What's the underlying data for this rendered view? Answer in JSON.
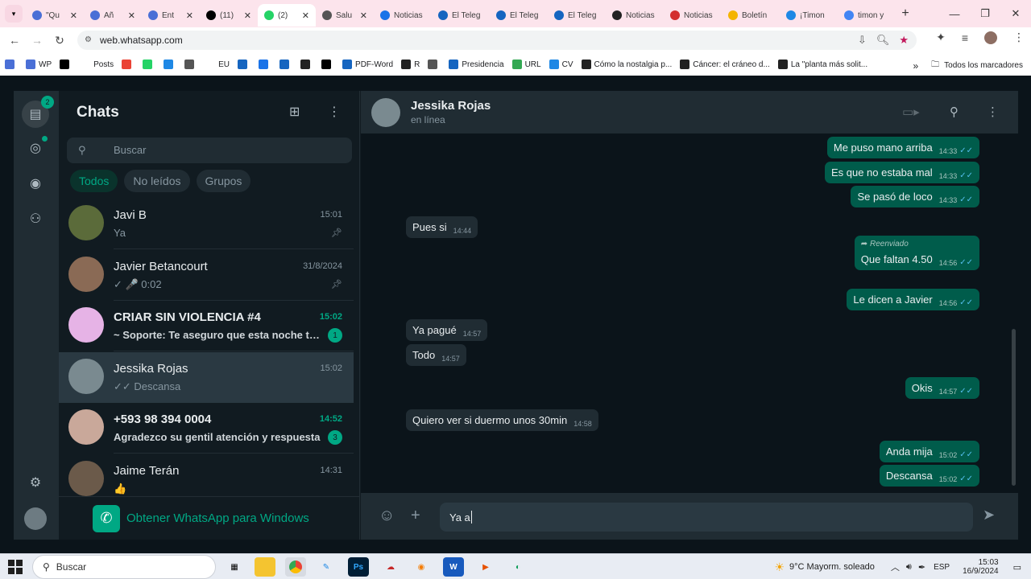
{
  "browser": {
    "tabs": [
      {
        "label": "\"Qu",
        "icon": "cw-icon",
        "color": "#4a6fd6"
      },
      {
        "label": "Añ",
        "icon": "cw-icon",
        "color": "#4a6fd6"
      },
      {
        "label": "Ent",
        "icon": "cw-icon",
        "color": "#4a6fd6"
      },
      {
        "label": "(11)",
        "icon": "x-icon",
        "color": "#000000"
      },
      {
        "label": "(2)",
        "icon": "whatsapp-icon",
        "color": "#25d366",
        "active": true
      },
      {
        "label": "Salu",
        "icon": "globe-icon",
        "color": "#555555"
      },
      {
        "label": "Noticias",
        "icon": "ec-icon",
        "color": "#1a73e8"
      },
      {
        "label": "El Teleg",
        "icon": "telegrafo-icon",
        "color": "#1565c0"
      },
      {
        "label": "El Teleg",
        "icon": "telegrafo-icon",
        "color": "#1565c0"
      },
      {
        "label": "El Teleg",
        "icon": "telegrafo-icon",
        "color": "#1565c0"
      },
      {
        "label": "Noticias",
        "icon": "dots-icon",
        "color": "#222222"
      },
      {
        "label": "Noticias",
        "icon": "ta-icon",
        "color": "#d32f2f"
      },
      {
        "label": "Boletín",
        "icon": "boletin-icon",
        "color": "#f4b400"
      },
      {
        "label": "¡Timon",
        "icon": "copilot-icon",
        "color": "#1e88e5"
      },
      {
        "label": "timon y",
        "icon": "google-icon",
        "color": "#4285f4"
      }
    ],
    "url": "web.whatsapp.com",
    "bookmarks": [
      {
        "label": "",
        "color": "#4a6fd6"
      },
      {
        "label": "WP",
        "color": "#4a6fd6"
      },
      {
        "label": "",
        "color": "#000000"
      },
      {
        "label": "Posts",
        "color": "#ffffff"
      },
      {
        "label": "",
        "color": "#ea4335"
      },
      {
        "label": "",
        "color": "#25d366"
      },
      {
        "label": "",
        "color": "#1e88e5"
      },
      {
        "label": "",
        "color": "#555555"
      },
      {
        "label": "EU",
        "color": "#ffffff"
      },
      {
        "label": "",
        "color": "#1565c0"
      },
      {
        "label": "",
        "color": "#1a73e8"
      },
      {
        "label": "",
        "color": "#1565c0"
      },
      {
        "label": "",
        "color": "#222222"
      },
      {
        "label": "",
        "color": "#000000"
      },
      {
        "label": "PDF-Word",
        "color": "#1565c0"
      },
      {
        "label": "R",
        "color": "#222222"
      },
      {
        "label": "",
        "color": "#555555"
      },
      {
        "label": "Presidencia",
        "color": "#1565c0"
      },
      {
        "label": "URL",
        "color": "#34a853"
      },
      {
        "label": "CV",
        "color": "#1e88e5"
      },
      {
        "label": "Cómo la nostalgia p...",
        "color": "#222222"
      },
      {
        "label": "Cáncer: el cráneo d...",
        "color": "#222222"
      },
      {
        "label": "La \"planta más solit...",
        "color": "#222222"
      }
    ],
    "all_bookmarks": "Todos los marcadores"
  },
  "app": {
    "rail_badge": "2",
    "title": "Chats",
    "search_placeholder": "Buscar",
    "filters": [
      {
        "label": "Todos",
        "active": true
      },
      {
        "label": "No leídos",
        "active": false
      },
      {
        "label": "Grupos",
        "active": false
      }
    ],
    "chats": [
      {
        "name": "Javi B",
        "preview": "Ya",
        "time": "15:01",
        "pinned": true,
        "avatar": "#5b6b3a"
      },
      {
        "name": "Javier Betancourt",
        "preview": "✓ 🎤 0:02",
        "time": "31/8/2024",
        "pinned": true,
        "avatar": "#8a6a55"
      },
      {
        "name": "CRIAR SIN VIOLENCIA #4",
        "preview": "~ Soporte: Te aseguro que esta noche tu cab...",
        "time": "15:02",
        "unread": "1",
        "bold": true,
        "avatar": "#e6b3e6"
      },
      {
        "name": "Jessika Rojas",
        "preview": "✓✓ Descansa",
        "time": "15:02",
        "selected": true,
        "avatar": "#7a8a90"
      },
      {
        "name": "+593 98 394 0004",
        "preview": "Agradezco su gentil atención y respuesta",
        "time": "14:52",
        "unread": "3",
        "bold": true,
        "avatar": "#c9a89a"
      },
      {
        "name": "Jaime Terán",
        "preview": "👍",
        "time": "14:31",
        "avatar": "#6b5a4a"
      }
    ],
    "get_windows": "Obtener WhatsApp para Windows",
    "contact": {
      "name": "Jessika Rojas",
      "status": "en línea"
    },
    "messages": [
      {
        "dir": "out",
        "text": "Me puso mano arriba",
        "time": "14:33"
      },
      {
        "dir": "out",
        "text": "Es que no estaba mal",
        "time": "14:33"
      },
      {
        "dir": "out",
        "text": "Se pasó de loco",
        "time": "14:33"
      },
      {
        "dir": "in",
        "text": "Pues si",
        "time": "14:44"
      },
      {
        "dir": "out",
        "text": "Que faltan 4.50",
        "time": "14:56",
        "forwarded": "Reenviado"
      },
      {
        "dir": "out",
        "text": "Le dicen a Javier",
        "time": "14:56"
      },
      {
        "dir": "in",
        "text": "Ya pagué",
        "time": "14:57"
      },
      {
        "dir": "in",
        "text": "Todo",
        "time": "14:57"
      },
      {
        "dir": "out",
        "text": "Okis",
        "time": "14:57"
      },
      {
        "dir": "in",
        "text": "Quiero ver si duermo unos 30min",
        "time": "14:58"
      },
      {
        "dir": "out",
        "text": "Anda mija",
        "time": "15:02"
      },
      {
        "dir": "out",
        "text": "Descansa",
        "time": "15:02"
      }
    ],
    "composer_text": "Ya a"
  },
  "taskbar": {
    "search": "Buscar",
    "weather": "9°C  Mayorm. soleado",
    "lang": "ESP",
    "time": "15:03",
    "date": "16/9/2024"
  }
}
